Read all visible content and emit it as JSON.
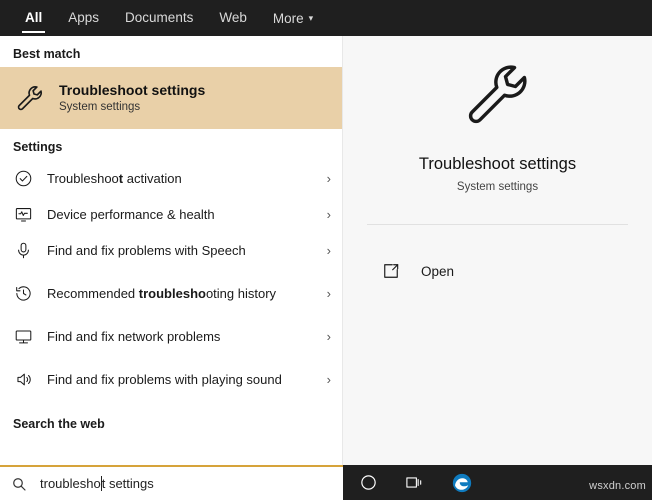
{
  "topbar": {
    "tabs": [
      {
        "label": "All",
        "active": true,
        "chevron": false
      },
      {
        "label": "Apps",
        "active": false,
        "chevron": false
      },
      {
        "label": "Documents",
        "active": false,
        "chevron": false
      },
      {
        "label": "Web",
        "active": false,
        "chevron": false
      },
      {
        "label": "More",
        "active": false,
        "chevron": true
      }
    ],
    "chevron_glyph": "▾"
  },
  "left": {
    "best_match_header": "Best match",
    "best_match": {
      "title": "Troubleshoot settings",
      "subtitle": "System settings",
      "icon": "wrench-icon"
    },
    "settings_header": "Settings",
    "settings_items": [
      {
        "label_pre": "Troubleshoo",
        "label_bold": "t",
        "label_post": " activation",
        "icon": "check-circle-icon",
        "chevron": "›"
      },
      {
        "label_pre": "Device performance & health",
        "label_bold": "",
        "label_post": "",
        "icon": "heart-monitor-icon",
        "chevron": "›"
      },
      {
        "label_pre": "Find and fix problems with Speech",
        "label_bold": "",
        "label_post": "",
        "icon": "microphone-icon",
        "chevron": "›"
      },
      {
        "label_pre": "Recommended ",
        "label_bold": "troublesho",
        "label_post": "oting history",
        "icon": "history-icon",
        "chevron": "›"
      },
      {
        "label_pre": "Find and fix network problems",
        "label_bold": "",
        "label_post": "",
        "icon": "network-icon",
        "chevron": "›"
      },
      {
        "label_pre": "Find and fix problems with playing sound",
        "label_bold": "",
        "label_post": "",
        "icon": "speaker-icon",
        "chevron": "›"
      }
    ],
    "web_header": "Search the web"
  },
  "right": {
    "title": "Troubleshoot settings",
    "subtitle": "System settings",
    "icon": "wrench-icon",
    "actions": [
      {
        "label": "Open",
        "icon": "open-external-icon"
      }
    ]
  },
  "taskbar": {
    "search_value": "troublesho",
    "search_value_rest": "t settings",
    "icons": [
      {
        "name": "cortana-circle-icon"
      },
      {
        "name": "task-view-icon"
      },
      {
        "name": "edge-browser-icon"
      }
    ]
  },
  "watermark": "wsxdn.com"
}
